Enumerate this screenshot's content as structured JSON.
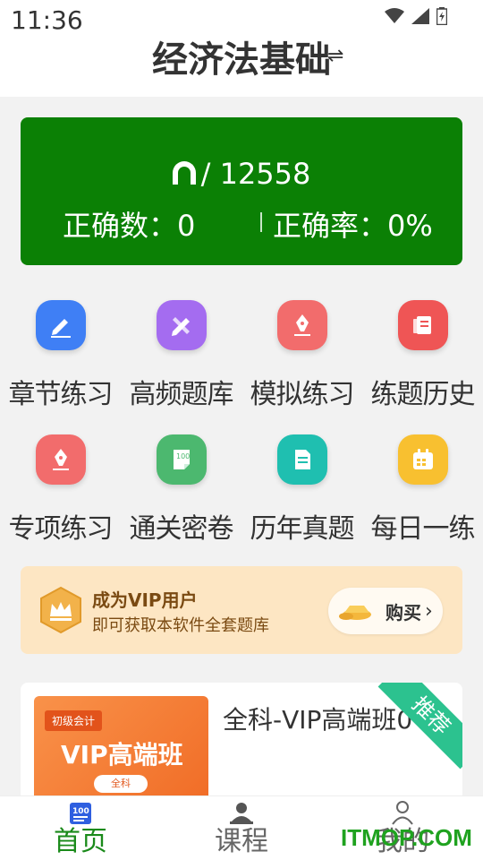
{
  "status_bar": {
    "time": "11:36"
  },
  "header": {
    "title": "经济法基础",
    "swap_icon": "⇌"
  },
  "score": {
    "progress_separator": "/ 12558",
    "correct_count": "正确数：0",
    "correct_rate": "正确率：0%"
  },
  "features": [
    {
      "label": "章节练习",
      "icon": "edit-icon",
      "color": "#3f7ff5"
    },
    {
      "label": "高频题库",
      "icon": "pencil-ruler-icon",
      "color": "#a46cf0"
    },
    {
      "label": "模拟练习",
      "icon": "pen-nib-icon",
      "color": "#f26c6c"
    },
    {
      "label": "练题历史",
      "icon": "history-note-icon",
      "color": "#ef5555"
    },
    {
      "label": "专项练习",
      "icon": "pen-nib-icon",
      "color": "#f26c6c"
    },
    {
      "label": "通关密卷",
      "icon": "score-paper-icon",
      "color": "#4cb86f"
    },
    {
      "label": "历年真题",
      "icon": "document-icon",
      "color": "#1fbfb0"
    },
    {
      "label": "每日一练",
      "icon": "calendar-icon",
      "color": "#f8c030"
    }
  ],
  "vip": {
    "title": "成为VIP用户",
    "subtitle": "即可获取本软件全套题库",
    "buy_label": "购买",
    "chevron": "›"
  },
  "course": {
    "thumb_tag": "初级会计",
    "thumb_title": "VIP高端班",
    "thumb_pill": "全科",
    "name": "全科-VIP高端班0",
    "ribbon": "推荐"
  },
  "tabbar": {
    "home": "首页",
    "courses": "课程",
    "mine": "我的",
    "home_icon_text": "100"
  },
  "watermark": "ITMOP.COM"
}
